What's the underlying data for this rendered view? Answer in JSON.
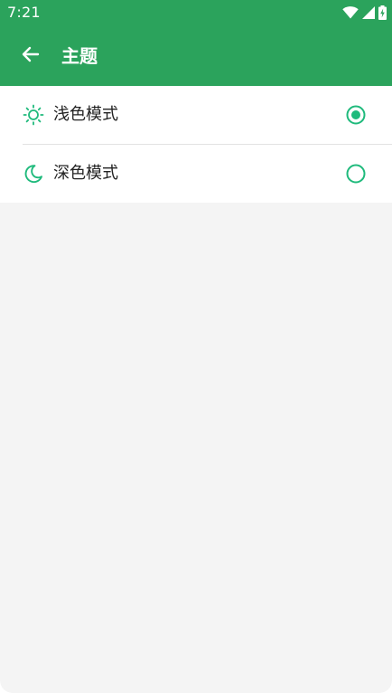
{
  "status_bar": {
    "time": "7:21",
    "icons": [
      "wifi-icon",
      "signal-icon",
      "battery-icon"
    ]
  },
  "app_bar": {
    "back_icon": "arrow-back-icon",
    "title": "主题"
  },
  "theme_options": [
    {
      "label": "浅色模式",
      "icon": "sun-icon",
      "selected": true
    },
    {
      "label": "深色模式",
      "icon": "moon-icon",
      "selected": false
    }
  ],
  "colors": {
    "primary": "#2ba35c",
    "accent": "#1fba7c",
    "background": "#f4f4f4",
    "surface": "#ffffff",
    "text": "#222222",
    "divider": "#e2e2e2"
  }
}
